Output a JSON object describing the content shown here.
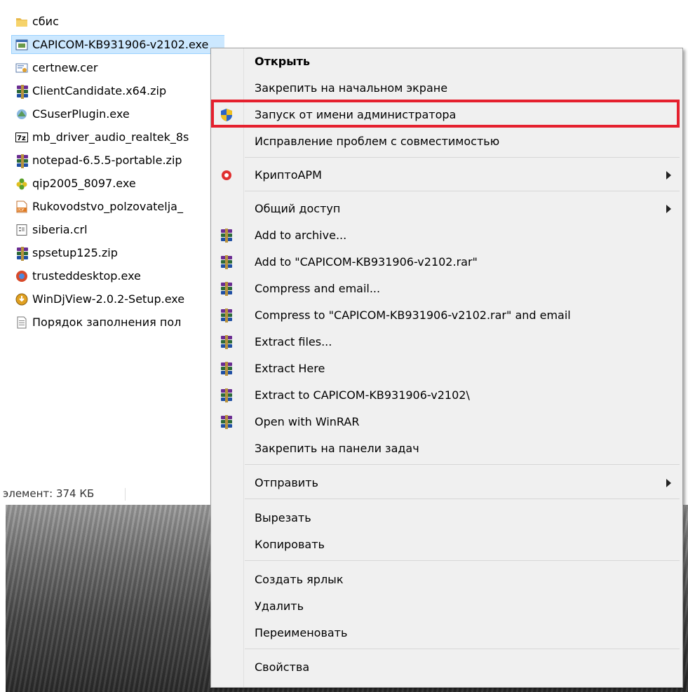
{
  "files": [
    {
      "name": "сбис",
      "icon": "folder-icon",
      "selected": false
    },
    {
      "name": "CAPICOM-KB931906-v2102.exe",
      "icon": "installer-exe-icon",
      "selected": true
    },
    {
      "name": "certnew.cer",
      "icon": "certificate-icon",
      "selected": false
    },
    {
      "name": "ClientCandidate.x64.zip",
      "icon": "winrar-archive-icon",
      "selected": false
    },
    {
      "name": "CSuserPlugin.exe",
      "icon": "plugin-exe-icon",
      "selected": false
    },
    {
      "name": "mb_driver_audio_realtek_8s",
      "icon": "7zip-archive-icon",
      "selected": false
    },
    {
      "name": "notepad-6.5.5-portable.zip",
      "icon": "winrar-archive-icon",
      "selected": false
    },
    {
      "name": "qip2005_8097.exe",
      "icon": "qip-flower-icon",
      "selected": false
    },
    {
      "name": "Rukovodstvo_polzovatelja_",
      "icon": "pdf-icon",
      "selected": false
    },
    {
      "name": "siberia.crl",
      "icon": "crl-file-icon",
      "selected": false
    },
    {
      "name": "spsetup125.zip",
      "icon": "winrar-archive-icon",
      "selected": false
    },
    {
      "name": "trusteddesktop.exe",
      "icon": "trusteddesktop-icon",
      "selected": false
    },
    {
      "name": "WinDjView-2.0.2-Setup.exe",
      "icon": "windjview-setup-icon",
      "selected": false
    },
    {
      "name": "Порядок заполнения пол",
      "icon": "text-document-icon",
      "selected": false
    }
  ],
  "statusbar": {
    "text": "элемент: 374 КБ"
  },
  "menu": {
    "open": "Открыть",
    "pin_start": "Закрепить на начальном экране",
    "run_as_admin": "Запуск от имени администратора",
    "compat": "Исправление проблем с совместимостью",
    "cryptoarm": "КриптоАРМ",
    "share": "Общий доступ",
    "add_archive": "Add to archive...",
    "add_rar": "Add to \"CAPICOM-KB931906-v2102.rar\"",
    "compress_email": "Compress and email...",
    "compress_rar_email": "Compress to \"CAPICOM-KB931906-v2102.rar\" and email",
    "extract_files": "Extract files...",
    "extract_here": "Extract Here",
    "extract_to": "Extract to CAPICOM-KB931906-v2102\\",
    "open_winrar": "Open with WinRAR",
    "pin_taskbar": "Закрепить на панели задач",
    "send_to": "Отправить",
    "cut": "Вырезать",
    "copy": "Копировать",
    "create_shortcut": "Создать ярлык",
    "delete": "Удалить",
    "rename": "Переименовать",
    "properties": "Свойства"
  },
  "colors": {
    "highlight_border": "#e5202e",
    "selection": "#cce8ff",
    "menu_bg": "#f0f0f0"
  }
}
